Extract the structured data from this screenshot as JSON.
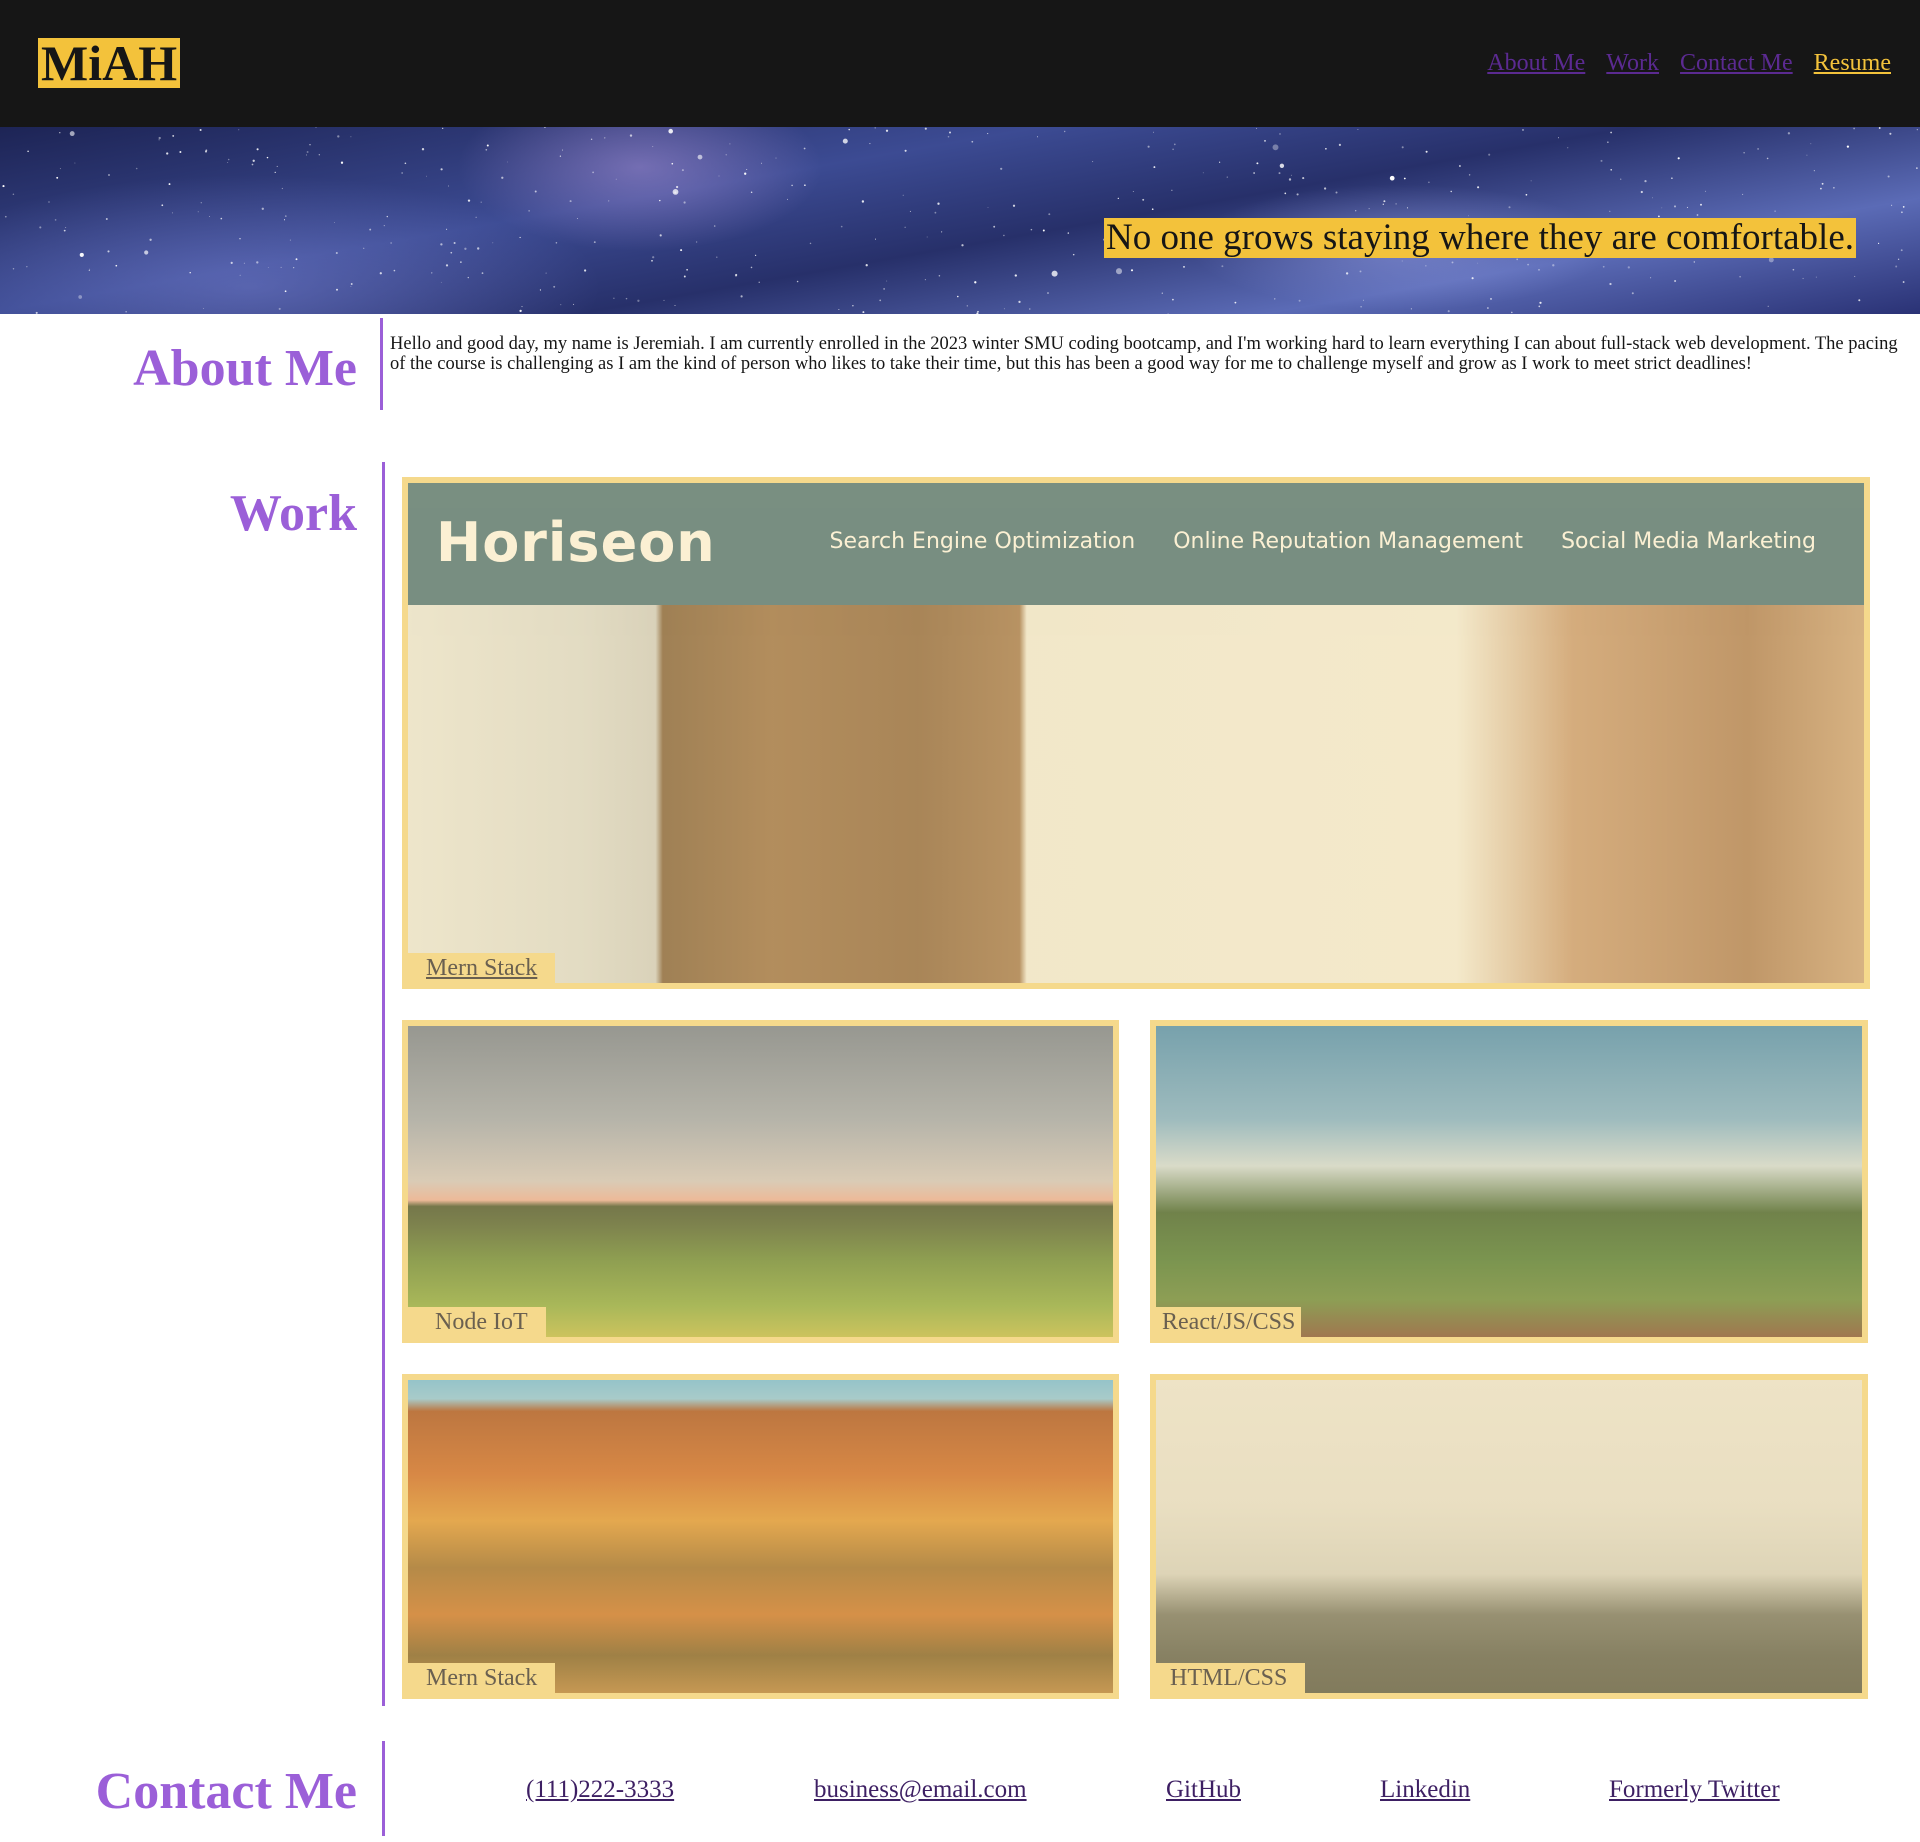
{
  "header": {
    "logo": "MiAH",
    "nav": [
      {
        "label": "About Me"
      },
      {
        "label": "Work"
      },
      {
        "label": "Contact Me"
      },
      {
        "label": "Resume"
      }
    ]
  },
  "hero": {
    "tagline": "No one grows staying where they are comfortable."
  },
  "about": {
    "title": "About Me",
    "text": "Hello and good day, my name is Jeremiah. I am currently enrolled in the 2023 winter SMU coding bootcamp, and I'm working hard to learn everything I can about full-stack web development. The pacing of the course is challenging as I am the kind of person who likes to take their time, but this has been a good way for me to challenge myself and grow as I work to meet strict deadlines!"
  },
  "work": {
    "title": "Work",
    "featured": {
      "label": "Mern Stack",
      "screenshot": {
        "brand": "Horiseon",
        "nav": [
          "Search Engine Optimization",
          "Online Reputation Management",
          "Social Media Marketing"
        ]
      }
    },
    "projects": [
      {
        "label": "Node IoT"
      },
      {
        "label": "React/JS/CSS"
      },
      {
        "label": "Mern Stack"
      },
      {
        "label": "HTML/CSS"
      }
    ]
  },
  "contact": {
    "title": "Contact Me",
    "links": [
      {
        "label": "(111)222-3333"
      },
      {
        "label": "business@email.com"
      },
      {
        "label": "GitHub"
      },
      {
        "label": "Linkedin"
      },
      {
        "label": "Formerly Twitter"
      }
    ]
  },
  "colors": {
    "header_bg": "#161616",
    "accent_gold": "#f3c23b",
    "accent_purple": "#9b5fd8",
    "card_border": "#f5d98c"
  }
}
